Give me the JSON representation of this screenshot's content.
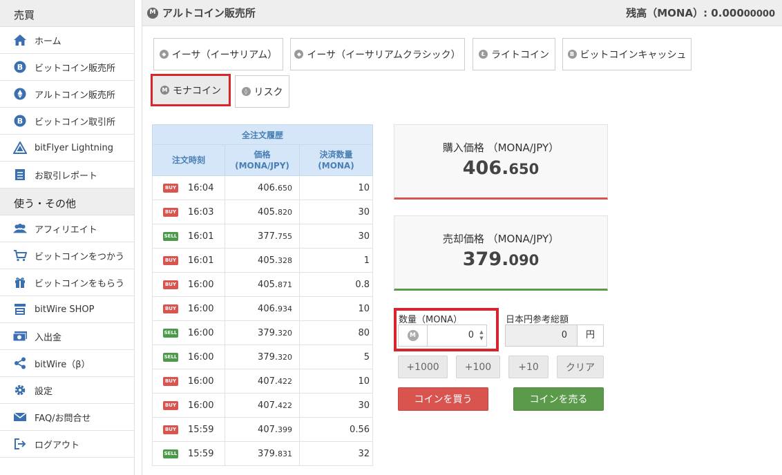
{
  "sidebar": {
    "section1": "売買",
    "items1": [
      {
        "label": "ホーム",
        "icon": "home-icon"
      },
      {
        "label": "ビットコイン販売所",
        "icon": "bitcoin-icon"
      },
      {
        "label": "アルトコイン販売所",
        "icon": "ethereum-icon"
      },
      {
        "label": "ビットコイン取引所",
        "icon": "bitcoin-icon"
      },
      {
        "label": "bitFlyer Lightning",
        "icon": "lightning-icon"
      },
      {
        "label": "お取引レポート",
        "icon": "report-icon"
      }
    ],
    "section2": "使う・その他",
    "items2": [
      {
        "label": "アフィリエイト",
        "icon": "users-icon"
      },
      {
        "label": "ビットコインをつかう",
        "icon": "cart-icon"
      },
      {
        "label": "ビットコインをもらう",
        "icon": "gift-icon"
      },
      {
        "label": "bitWire SHOP",
        "icon": "shop-icon"
      },
      {
        "label": "入出金",
        "icon": "money-icon"
      },
      {
        "label": "bitWire（β）",
        "icon": "share-icon"
      },
      {
        "label": "設定",
        "icon": "gear-icon"
      },
      {
        "label": "FAQ/お問合せ",
        "icon": "mail-icon"
      },
      {
        "label": "ログアウト",
        "icon": "logout-icon"
      }
    ]
  },
  "header": {
    "title": "アルトコイン販売所",
    "balance_prefix": "残高（MONA）: 0.000",
    "balance_suffix": "00000"
  },
  "coin_tabs": [
    {
      "label": "イーサ（イーサリアム）",
      "icon": "ethereum-icon"
    },
    {
      "label": "イーサ（イーサリアムクラシック）",
      "icon": "ethereum-classic-icon"
    },
    {
      "label": "ライトコイン",
      "icon": "litecoin-icon"
    },
    {
      "label": "ビットコインキャッシュ",
      "icon": "bitcoin-cash-icon"
    },
    {
      "label": "モナコイン",
      "icon": "monacoin-icon",
      "active": true
    },
    {
      "label": "リスク",
      "icon": "lisk-icon"
    }
  ],
  "orders": {
    "caption": "全注文履歴",
    "col_time": "注文時刻",
    "col_price_1": "価格",
    "col_price_2": "(MONA/JPY)",
    "col_qty_1": "決済数量",
    "col_qty_2": "(MONA)",
    "rows": [
      {
        "side": "BUY",
        "time": "16:04",
        "price_int": "406.",
        "price_frac": "650",
        "qty": "10"
      },
      {
        "side": "BUY",
        "time": "16:03",
        "price_int": "405.",
        "price_frac": "820",
        "qty": "30"
      },
      {
        "side": "SELL",
        "time": "16:01",
        "price_int": "377.",
        "price_frac": "755",
        "qty": "30"
      },
      {
        "side": "BUY",
        "time": "16:01",
        "price_int": "405.",
        "price_frac": "328",
        "qty": "1"
      },
      {
        "side": "BUY",
        "time": "16:00",
        "price_int": "405.",
        "price_frac": "871",
        "qty": "0.8"
      },
      {
        "side": "BUY",
        "time": "16:00",
        "price_int": "406.",
        "price_frac": "934",
        "qty": "10"
      },
      {
        "side": "SELL",
        "time": "16:00",
        "price_int": "379.",
        "price_frac": "320",
        "qty": "80"
      },
      {
        "side": "SELL",
        "time": "16:00",
        "price_int": "379.",
        "price_frac": "320",
        "qty": "5"
      },
      {
        "side": "BUY",
        "time": "16:00",
        "price_int": "407.",
        "price_frac": "422",
        "qty": "10"
      },
      {
        "side": "BUY",
        "time": "16:00",
        "price_int": "407.",
        "price_frac": "422",
        "qty": "30"
      },
      {
        "side": "BUY",
        "time": "15:59",
        "price_int": "407.",
        "price_frac": "399",
        "qty": "0.56"
      },
      {
        "side": "SELL",
        "time": "15:59",
        "price_int": "379.",
        "price_frac": "831",
        "qty": "32"
      }
    ]
  },
  "buy_price": {
    "label": "購入価格 （MONA/JPY）",
    "int": "406.",
    "frac": "650"
  },
  "sell_price": {
    "label": "売却価格 （MONA/JPY）",
    "int": "379.",
    "frac": "090"
  },
  "quantity": {
    "label": "数量（MONA）",
    "value": "0"
  },
  "jpy_total": {
    "label": "日本円参考総額",
    "value": "0",
    "unit": "円"
  },
  "quick_buttons": [
    "+1000",
    "+100",
    "+10",
    "クリア"
  ],
  "buy_button": "コインを買う",
  "sell_button": "コインを売る",
  "colors": {
    "buy": "#d9534f",
    "sell": "#5a9a4a",
    "highlight": "#d9232d",
    "table_header": "#d4e6f7"
  }
}
